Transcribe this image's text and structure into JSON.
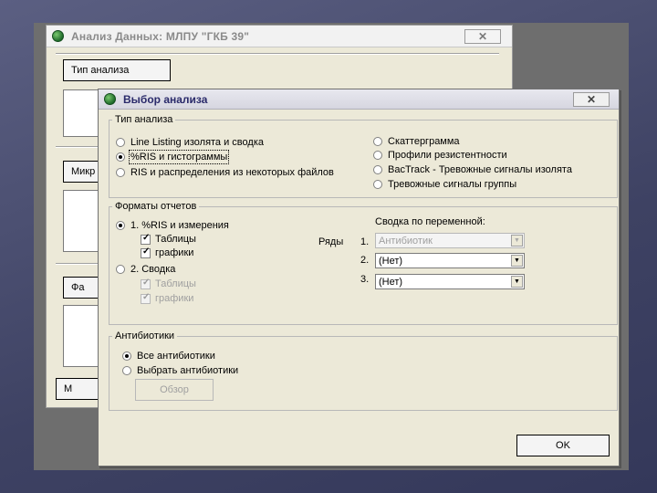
{
  "back_window": {
    "title": "Анализ Данных:  МЛПУ \"ГКБ 39\"",
    "close_label": "✕",
    "btn_analysis_type": "Тип анализа",
    "btn_micro": "Микр",
    "btn_fa": "Фа",
    "btn_m": "М"
  },
  "dialog": {
    "title": "Выбор анализа",
    "close_label": "✕",
    "analysis_type": {
      "legend": "Тип анализа",
      "left_options": [
        {
          "label": "Line Listing изолята и сводка",
          "selected": false
        },
        {
          "label": "%RIS и гистограммы",
          "selected": true
        },
        {
          "label": "RIS и распределения из некоторых файлов",
          "selected": false
        }
      ],
      "right_options": [
        {
          "label": "Скаттерграмма",
          "selected": false
        },
        {
          "label": "Профили резистентности",
          "selected": false
        },
        {
          "label": "BacTrack - Тревожные сигналы изолята",
          "selected": false
        },
        {
          "label": "Тревожные сигналы группы",
          "selected": false
        }
      ]
    },
    "report_formats": {
      "legend": "Форматы отчетов",
      "option1": {
        "label": "1. %RIS и измерения",
        "selected": true
      },
      "option1_checks": [
        {
          "label": "Таблицы",
          "checked": true
        },
        {
          "label": "графики",
          "checked": true
        }
      ],
      "option2": {
        "label": "2. Сводка",
        "selected": false
      },
      "option2_checks": [
        {
          "label": "Таблицы",
          "checked": true
        },
        {
          "label": "графики",
          "checked": true
        }
      ],
      "rows_label": "Ряды",
      "summary_label": "Сводка по переменной:",
      "variables": [
        {
          "num": "1.",
          "value": "Антибиотик",
          "enabled": false
        },
        {
          "num": "2.",
          "value": "(Нет)",
          "enabled": true
        },
        {
          "num": "3.",
          "value": "(Нет)",
          "enabled": true
        }
      ]
    },
    "antibiotics": {
      "legend": "Антибиотики",
      "options": [
        {
          "label": "Все антибиотики",
          "selected": true
        },
        {
          "label": "Выбрать антибиотики",
          "selected": false
        }
      ],
      "browse_label": "Обзор"
    },
    "ok_label": "OK"
  },
  "colors": {
    "dialog_bg": "#ece9d8",
    "title_text": "#2a2a6a",
    "disabled_text": "#a0a0a0"
  },
  "icons": {
    "dropdown": "▼",
    "app": "globe-icon"
  }
}
